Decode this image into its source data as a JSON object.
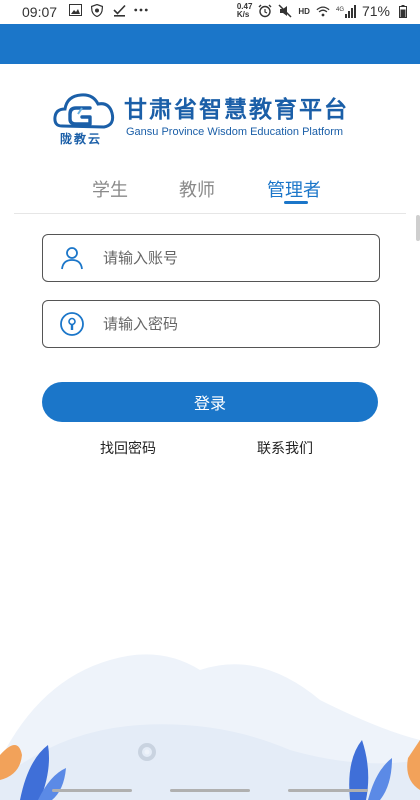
{
  "status_bar": {
    "time": "09:07",
    "net_speed_value": "0.47",
    "net_speed_unit": "K/s",
    "hd_label": "HD",
    "network_label": "4G",
    "battery": "71%"
  },
  "logo": {
    "sub_label": "陇教云",
    "title": "甘肃省智慧教育平台",
    "subtitle_en": "Gansu Province Wisdom Education Platform"
  },
  "tabs": [
    {
      "label": "学生",
      "active": false
    },
    {
      "label": "教师",
      "active": false
    },
    {
      "label": "管理者",
      "active": true
    }
  ],
  "form": {
    "account_placeholder": "请输入账号",
    "password_placeholder": "请输入密码",
    "login_label": "登录",
    "forgot_password": "找回密码",
    "contact_us": "联系我们"
  },
  "colors": {
    "brand_blue": "#1b76c9",
    "logo_blue": "#1b5fa8"
  }
}
